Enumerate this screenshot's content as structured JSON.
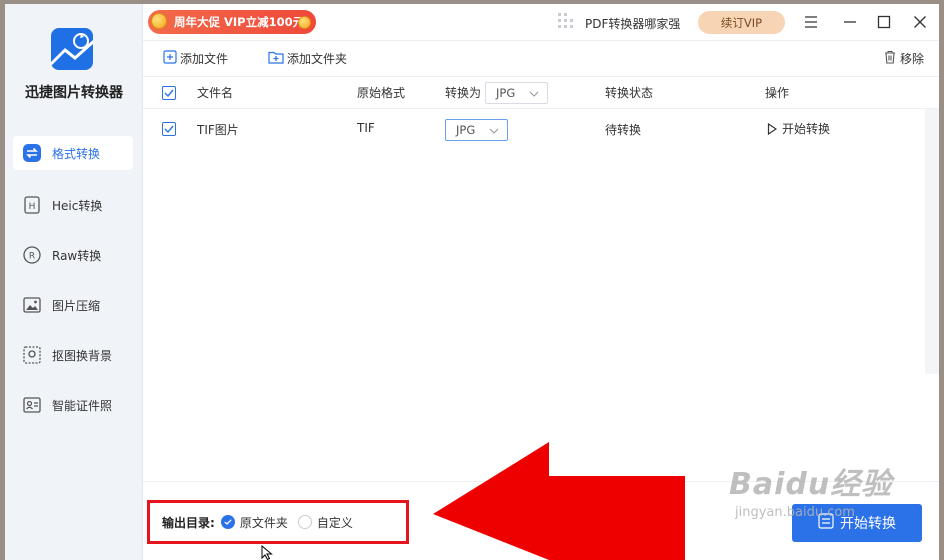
{
  "app": {
    "name": "迅捷图片转换器"
  },
  "sidebar": {
    "items": [
      {
        "label": "格式转换",
        "icon": "format-convert-icon",
        "active": true
      },
      {
        "label": "Heic转换",
        "icon": "heic-icon",
        "active": false
      },
      {
        "label": "Raw转换",
        "icon": "raw-icon",
        "active": false
      },
      {
        "label": "图片压缩",
        "icon": "image-compress-icon",
        "active": false
      },
      {
        "label": "抠图换背景",
        "icon": "cutout-icon",
        "active": false
      },
      {
        "label": "智能证件照",
        "icon": "id-photo-icon",
        "active": false
      }
    ]
  },
  "titlebar": {
    "promo": "周年大促 VIP立减100元",
    "pdf_link": "PDF转换器哪家强",
    "vip_button": "续订VIP"
  },
  "toolbar": {
    "add_file": "添加文件",
    "add_folder": "添加文件夹",
    "remove": "移除"
  },
  "table": {
    "headers": {
      "filename": "文件名",
      "orig_format": "原始格式",
      "convert_to": "转换为",
      "convert_to_value": "JPG",
      "status": "转换状态",
      "action": "操作"
    },
    "rows": [
      {
        "filename": "TIF图片",
        "orig_format": "TIF",
        "target": "JPG",
        "status": "待转换",
        "action": "开始转换",
        "checked": true
      }
    ]
  },
  "output": {
    "label": "输出目录:",
    "option_original": "原文件夹",
    "option_custom": "自定义",
    "selected": "原文件夹"
  },
  "start_all": "开始转换",
  "watermark": {
    "main": "Baidu经验",
    "sub": "jingyan.baidu.com"
  },
  "colors": {
    "accent": "#2b72e8",
    "highlight_red": "#e4141a",
    "promo": "#f0483a",
    "vip": "#f7d4b4"
  }
}
